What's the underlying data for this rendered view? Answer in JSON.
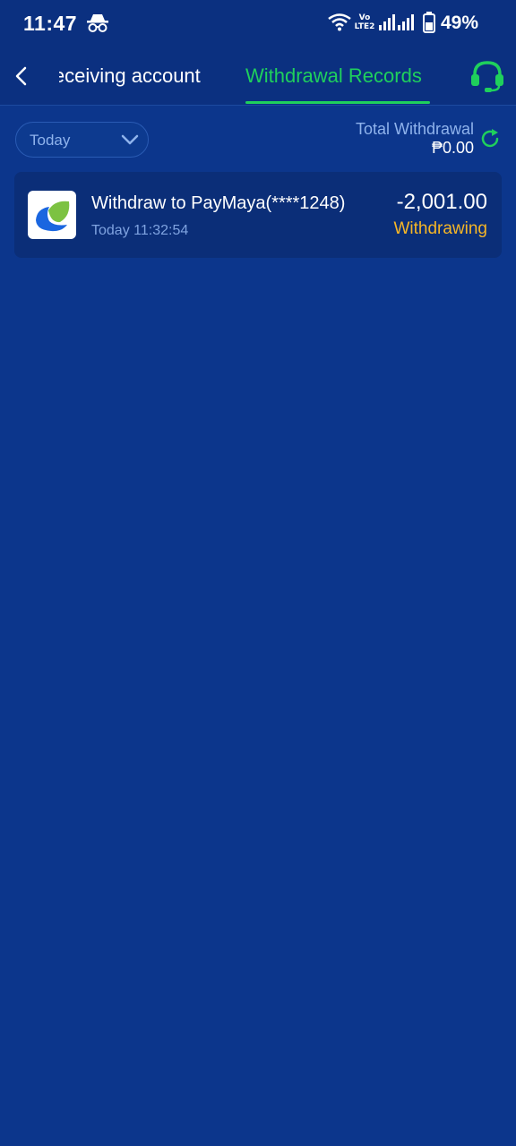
{
  "status_bar": {
    "time": "11:47",
    "network_label": "Vo LTE2",
    "battery": "49%"
  },
  "header": {
    "tab_receiving": "Receiving account",
    "tab_withdrawal_records": "Withdrawal Records",
    "accent_color": "#1fd05c"
  },
  "filter": {
    "date_label": "Today",
    "total_label": "Total Withdrawal",
    "total_value": "₱0.00"
  },
  "records": [
    {
      "title": "Withdraw to PayMaya(****1248)",
      "time": "Today 11:32:54",
      "amount": "-2,001.00",
      "status": "Withdrawing",
      "status_color": "#f6b626",
      "icon": "paymaya-logo-icon"
    }
  ],
  "icons": [
    "incognito-icon",
    "wifi-icon",
    "signal-icon",
    "battery-icon",
    "back-arrow-icon",
    "headset-icon",
    "chevron-down-icon",
    "refresh-icon"
  ]
}
